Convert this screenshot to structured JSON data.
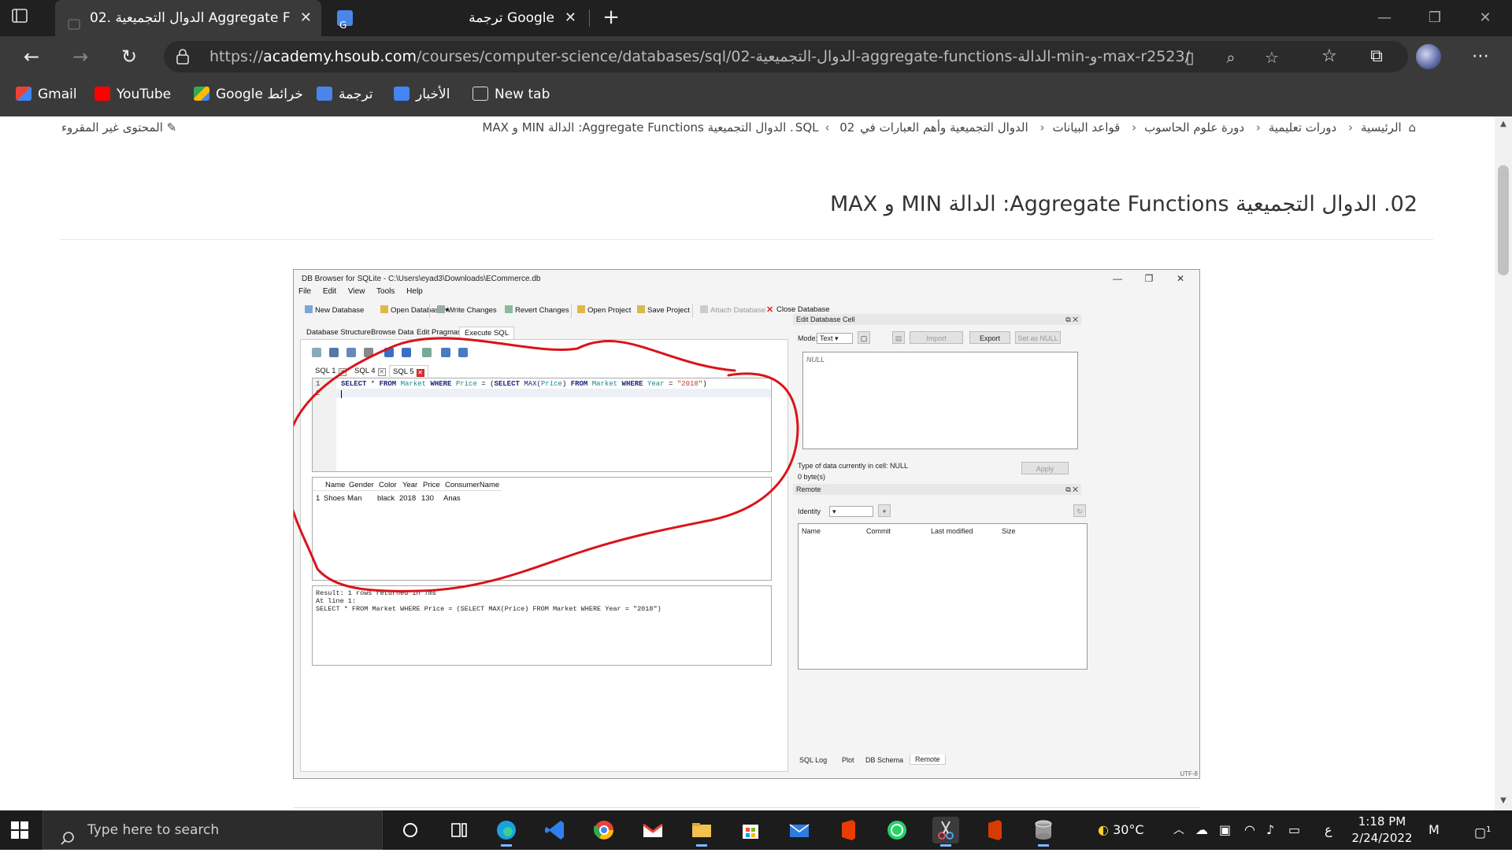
{
  "browser": {
    "tabs": [
      {
        "title": "02. الدوال التجميعية Aggregate Functions",
        "close": "✕"
      },
      {
        "title": "ترجمة Google",
        "close": "✕"
      }
    ],
    "new_tab": "+",
    "url_prefix": "https://",
    "url_domain": "academy.hsoub.com",
    "url_path": "/courses/computer-science/databases/sql/02-الدوال-التجميعية-aggregate-functions-الدالة-min-و-max-r2523/",
    "bookmarks": [
      "Gmail",
      "YouTube",
      "Google خرائط",
      "ترجمة",
      "الأخبار",
      "New tab"
    ]
  },
  "page": {
    "breadcrumb": [
      "الرئيسية",
      "دورات تعليمية",
      "دورة علوم الحاسوب",
      "قواعد البيانات",
      "الدوال التجميعية وأهم العبارات في SQL",
      "02. الدوال التجميعية Aggregate Functions: الدالة MIN و MAX"
    ],
    "unread": "المحتوى غير المقروء",
    "title": "02. الدوال التجميعية Aggregate Functions: الدالة MIN و MAX"
  },
  "dbapp": {
    "window_title": "DB Browser for SQLite - C:\\Users\\eyad3\\Downloads\\ECommerce.db",
    "menu": [
      "File",
      "Edit",
      "View",
      "Tools",
      "Help"
    ],
    "toolbar": [
      "New Database",
      "Open Database",
      "Write Changes",
      "Revert Changes",
      "Open Project",
      "Save Project",
      "Attach Database",
      "Close Database"
    ],
    "tabs": [
      "Database Structure",
      "Browse Data",
      "Edit Pragmas",
      "Execute SQL"
    ],
    "sql_tabs": [
      "SQL 1",
      "SQL 4",
      "SQL 5"
    ],
    "editor_lines": [
      "1",
      "2"
    ],
    "query": {
      "kw1": "SELECT",
      "star": " * ",
      "kw2": "FROM",
      "tbl": " Market ",
      "kw3": "WHERE",
      "col": " Price ",
      "eq": "= (",
      "kw4": "SELECT",
      "fn": " MAX(",
      "col2": "Price",
      "close": ") ",
      "kw5": "FROM",
      "tbl2": " Market ",
      "kw6": "WHERE",
      "col3": " Year ",
      "eq2": "= ",
      "str": "\"2018\"",
      "end": ")"
    },
    "results": {
      "columns": [
        "Name",
        "Gender",
        "Color",
        "Year",
        "Price",
        "ConsumerName"
      ],
      "rows": [
        {
          "n": "1",
          "cells": [
            "Shoes",
            "Man",
            "black",
            "2018",
            "130",
            "Anas"
          ]
        }
      ]
    },
    "message": "Result: 1 rows returned in 7ms\nAt line 1:\nSELECT * FROM Market WHERE Price = (SELECT MAX(Price) FROM Market WHERE Year = \"2018\")",
    "edit_cell": {
      "title": "Edit Database Cell",
      "mode_label": "Mode:",
      "mode_value": "Text",
      "import": "Import",
      "export": "Export",
      "set_null": "Set as NULL",
      "null_text": "NULL",
      "type_info": "Type of data currently in cell: NULL",
      "size_info": "0 byte(s)",
      "apply": "Apply"
    },
    "remote": {
      "title": "Remote",
      "identity": "Identity",
      "columns": [
        "Name",
        "Commit",
        "Last modified",
        "Size"
      ],
      "bottom_tabs": [
        "SQL Log",
        "Plot",
        "DB Schema",
        "Remote"
      ],
      "encoding": "UTF-8"
    }
  },
  "taskbar": {
    "search_placeholder": "Type here to search",
    "weather": "30°C",
    "lang": "ع",
    "time": "1:18 PM",
    "date": "2/24/2022",
    "notif": "1"
  }
}
